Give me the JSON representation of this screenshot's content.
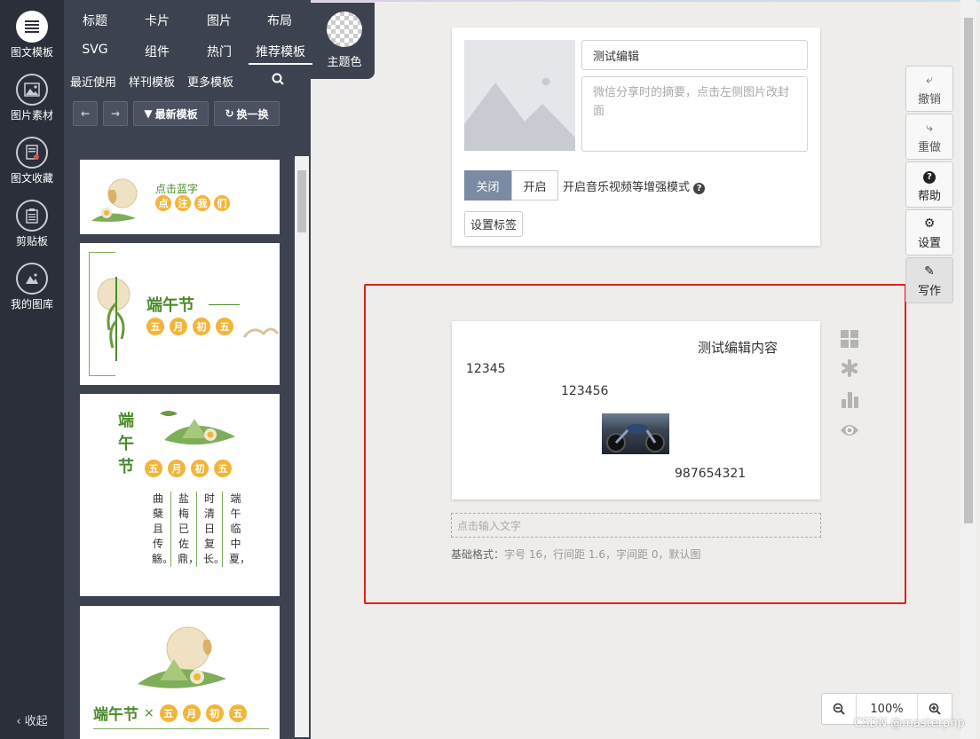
{
  "rail": {
    "items": [
      {
        "label": "图文模板",
        "icon": "list-icon"
      },
      {
        "label": "图片素材",
        "icon": "image-icon"
      },
      {
        "label": "图文收藏",
        "icon": "favorite-doc-icon"
      },
      {
        "label": "剪贴板",
        "icon": "clipboard-icon"
      },
      {
        "label": "我的图库",
        "icon": "gallery-icon"
      }
    ],
    "collapse": "收起"
  },
  "tabs": {
    "row1": [
      "标题",
      "卡片",
      "图片",
      "布局"
    ],
    "row2": [
      "SVG",
      "组件",
      "热门",
      "推荐模板"
    ],
    "theme": "主题色"
  },
  "subnav": [
    "最近使用",
    "样刊模板",
    "更多模板"
  ],
  "toolbar": {
    "newest": "最新模板",
    "shuffle": "换一换"
  },
  "templates": {
    "t1": {
      "top": "点击蓝字",
      "chars": [
        "点",
        "注",
        "我",
        "们"
      ]
    },
    "t2": {
      "title": "端午节",
      "chars": [
        "五",
        "月",
        "初",
        "五"
      ]
    },
    "t3": {
      "vtitle": [
        "端",
        "午",
        "节"
      ],
      "chars": [
        "五",
        "月",
        "初",
        "五"
      ],
      "cols": [
        "曲蘖且传觞。",
        "盐梅已佐鼎，",
        "时清日复长。",
        "端午临中夏，"
      ]
    },
    "t4": {
      "title": "端午节",
      "x": "×",
      "chars": [
        "五",
        "月",
        "初",
        "五"
      ]
    }
  },
  "editor": {
    "title_value": "测试编辑",
    "summary_placeholder": "微信分享时的摘要，点击左侧图片改封面",
    "toggle_off": "关闭",
    "toggle_on": "开启",
    "music_label": "开启音乐视频等增强模式",
    "tag_button": "设置标签"
  },
  "content": {
    "line1": "测试编辑内容",
    "line2": "12345",
    "line3": "123456",
    "line4": "987654321",
    "input_placeholder": "点击输入文字",
    "format_label": "基础格式：",
    "format_detail": "字号 16，行间距 1.6，字间距 0，默认图"
  },
  "right_tools": [
    {
      "label": "撤销",
      "icon": "undo-icon"
    },
    {
      "label": "重做",
      "icon": "redo-icon"
    },
    {
      "label": "帮助",
      "icon": "help-icon"
    },
    {
      "label": "设置",
      "icon": "gear-icon"
    },
    {
      "label": "写作",
      "icon": "pencil-icon"
    }
  ],
  "zoom": {
    "value": "100%"
  },
  "watermark": "CSDN @masterphp",
  "colors": {
    "rail": "#2b2f3a",
    "panel": "#3d4250",
    "highlight": "#e0201c",
    "accent_green": "#4a8a2a",
    "accent_yellow": "#f2b53a",
    "toggle_active": "#7b8ba3"
  }
}
